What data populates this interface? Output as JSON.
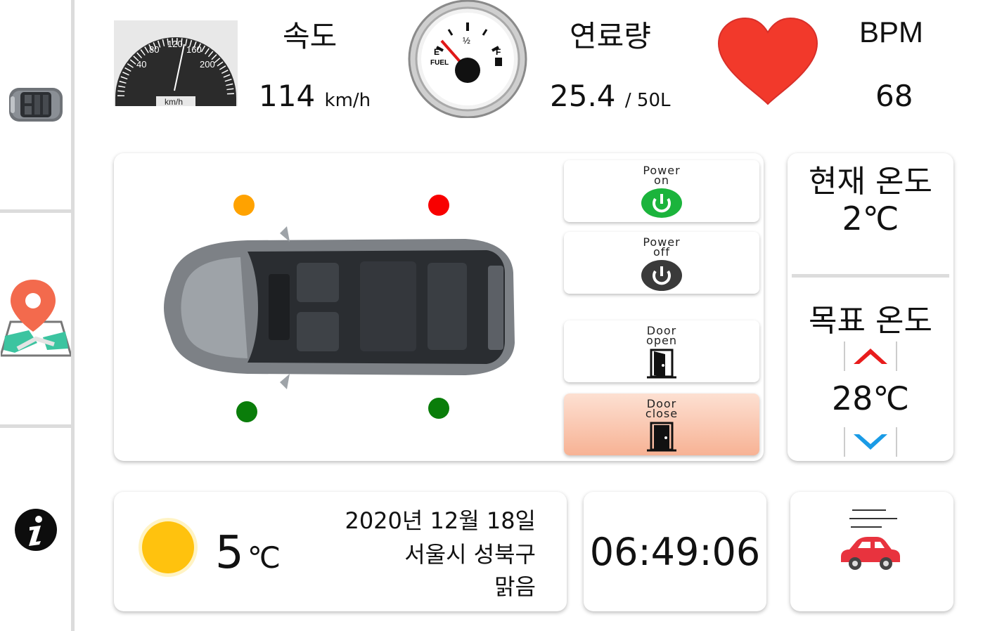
{
  "gauges": {
    "speed": {
      "label": "속도",
      "value": "114",
      "unit": "km/h",
      "dial_unit": "km/h",
      "dial_ticks": [
        "40",
        "80",
        "120",
        "160",
        "200"
      ]
    },
    "fuel": {
      "label": "연료량",
      "value": "25.4",
      "capacity": "/ 50L",
      "dial_labels": {
        "empty": "E",
        "half": "½",
        "full": "F",
        "caption": "FUEL"
      }
    },
    "heart": {
      "label": "BPM",
      "value": "68"
    }
  },
  "vehicle": {
    "status_dots": [
      {
        "position": "front-left",
        "color": "#ffa200"
      },
      {
        "position": "front-right",
        "color": "#f80000"
      },
      {
        "position": "rear-left",
        "color": "#0a7d0a"
      },
      {
        "position": "rear-right",
        "color": "#0a7d0a"
      }
    ],
    "controls": [
      {
        "id": "power-on",
        "line1": "Power",
        "line2": "on",
        "icon": "power-icon",
        "icon_color": "#1bb43c",
        "active": false
      },
      {
        "id": "power-off",
        "line1": "Power",
        "line2": "off",
        "icon": "power-icon",
        "icon_color": "#3a3a3a",
        "active": false
      },
      {
        "id": "door-open",
        "line1": "Door",
        "line2": "open",
        "icon": "door-icon",
        "active": false
      },
      {
        "id": "door-close",
        "line1": "Door",
        "line2": "close",
        "icon": "door-icon",
        "active": true
      }
    ]
  },
  "climate": {
    "current_label": "현재 온도",
    "current_value": "2℃",
    "target_label": "목표 온도",
    "target_value": "28℃",
    "up_color": "#e81c1c",
    "down_color": "#1a9be6"
  },
  "weather": {
    "temp_value": "5",
    "temp_unit": "℃",
    "date": "2020년 12월 18일",
    "location": "서울시 성북구",
    "condition": "맑음",
    "icon": "sun-icon"
  },
  "clock": {
    "time": "06:49:06"
  },
  "drive": {
    "icon": "moving-car-icon",
    "color": "#e8333e"
  },
  "sidebar": {
    "items": [
      {
        "id": "car",
        "icon": "car-topview-icon"
      },
      {
        "id": "map",
        "icon": "map-pin-icon"
      },
      {
        "id": "info",
        "icon": "info-icon"
      }
    ]
  },
  "colors": {
    "heart": "#f2392b",
    "sun": "#ffc20e",
    "active_button": "#f7b294"
  }
}
